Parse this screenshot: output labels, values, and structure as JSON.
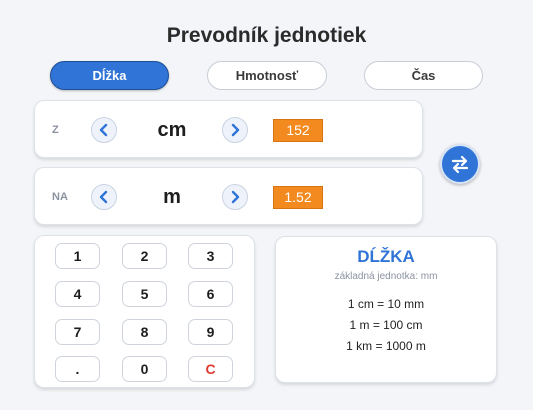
{
  "app": {
    "title": "Prevodník jednotiek"
  },
  "tabs": [
    {
      "label": "Dĺžka",
      "active": true
    },
    {
      "label": "Hmotnosť",
      "active": false
    },
    {
      "label": "Čas",
      "active": false
    }
  ],
  "converter": {
    "from": {
      "label": "Z",
      "unit": "cm",
      "value": "152"
    },
    "to": {
      "label": "NA",
      "unit": "m",
      "value": "1.52"
    },
    "swap_icon": "swap-arrows-icon"
  },
  "keypad": {
    "keys": [
      "1",
      "2",
      "3",
      "4",
      "5",
      "6",
      "7",
      "8",
      "9",
      ".",
      "0",
      "C"
    ]
  },
  "info": {
    "title": "DĹŽKA",
    "subtitle": "základná jednotka: mm",
    "conversions": [
      "1 cm = 10 mm",
      "1 m = 100 cm",
      "1 km = 1000 m"
    ]
  },
  "colors": {
    "accent": "#2f74d6",
    "value_box": "#f28a1f",
    "clear_key": "#e03a2e"
  }
}
